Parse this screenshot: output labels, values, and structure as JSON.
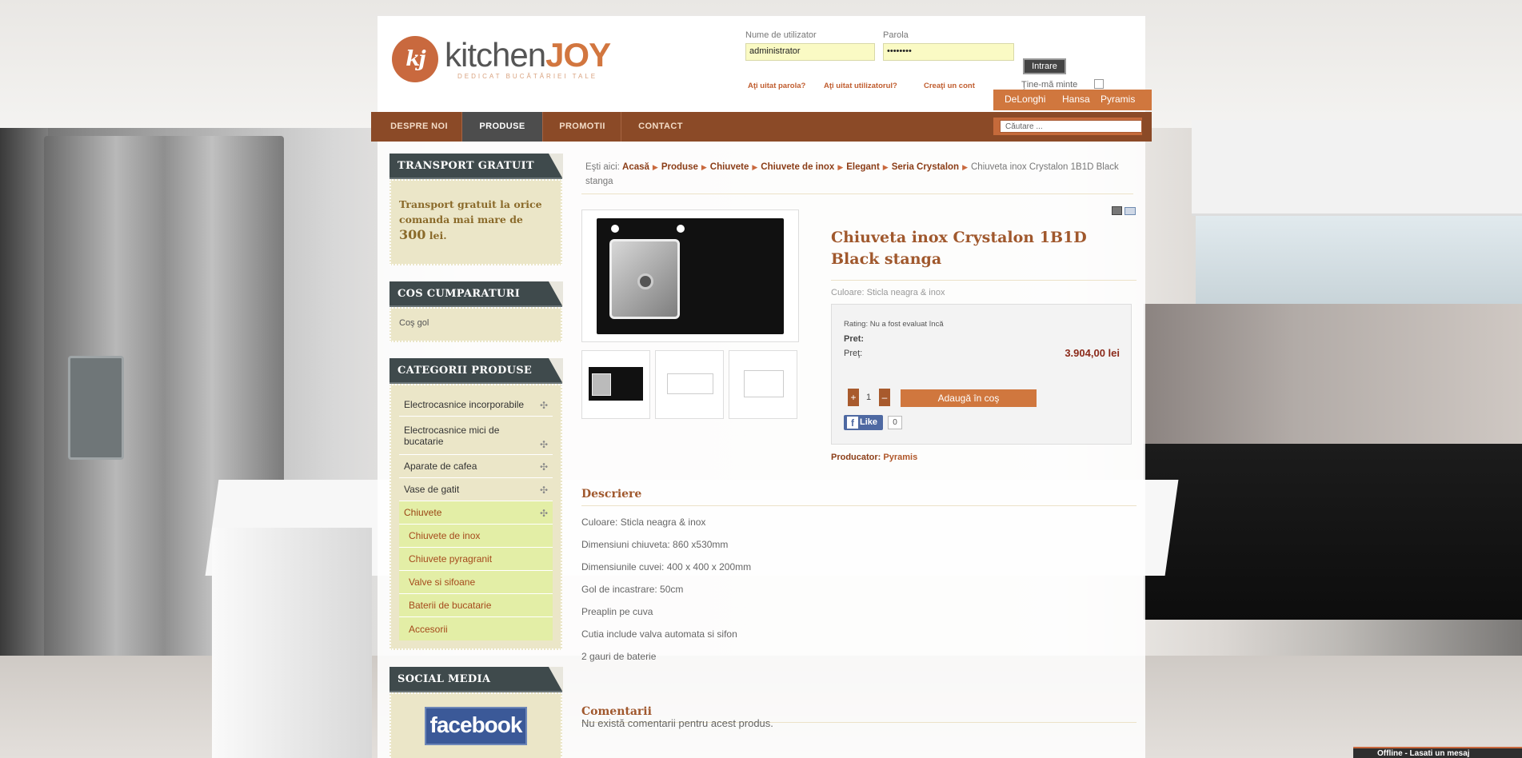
{
  "header": {
    "logo_mark": "kj",
    "logo_kitchen": "kitchen",
    "logo_joy": "JOY",
    "logo_tagline": "DEDICAT BUCĂTĂRIEI TALE",
    "login": {
      "username_label": "Nume de utilizator",
      "username_value": "administrator",
      "password_label": "Parola",
      "password_value": "••••••••",
      "submit_label": "Intrare",
      "forgot_password": "Aţi uitat parola?",
      "forgot_username": "Aţi uitat utilizatorul?",
      "create_account": "Creaţi un cont",
      "remember_label": "Ţine-mă minte"
    },
    "brands": [
      "DeLonghi",
      "Hansa",
      "Pyramis"
    ],
    "nav": [
      "DESPRE NOI",
      "PRODUSE",
      "PROMOTII",
      "CONTACT"
    ],
    "search_placeholder": "Căutare ..."
  },
  "sidebar": {
    "transport": {
      "title": "TRANSPORT GRATUIT",
      "text": "Transport gratuit la orice comanda mai mare de",
      "amount": "300",
      "currency": "lei."
    },
    "cart": {
      "title": "COS CUMPARATURI",
      "empty": "Coş gol"
    },
    "categories": {
      "title": "CATEGORII PRODUSE",
      "items": [
        "Electrocasnice incorporabile",
        "Electrocasnice mici de bucatarie",
        "Aparate de cafea",
        "Vase de gatit",
        "Chiuvete"
      ],
      "subitems": [
        "Chiuvete de inox",
        "Chiuvete pyragranit",
        "Valve si sifoane",
        "Baterii de bucatarie",
        "Accesorii"
      ]
    },
    "social": {
      "title": "SOCIAL MEDIA",
      "facebook": "facebook"
    }
  },
  "breadcrumb": {
    "prefix": "Eşti aici:",
    "items": [
      "Acasă",
      "Produse",
      "Chiuvete",
      "Chiuvete de inox",
      "Elegant",
      "Seria Crystalon"
    ],
    "current": "Chiuveta inox Crystalon 1B1D Black stanga"
  },
  "product": {
    "title": "Chiuveta inox Crystalon 1B1D Black stanga",
    "color": "Culoare: Sticla neagra & inox",
    "rating": "Rating: Nu a fost evaluat încă",
    "price_heading": "Pret:",
    "price_label": "Preţ:",
    "price_value": "3.904,00 lei",
    "qty_plus": "+",
    "qty_value": "1",
    "qty_minus": "–",
    "add_to_cart": "Adaugă în coş",
    "fb_like": "Like",
    "fb_count": "0",
    "producer_label": "Producator:",
    "producer_value": "Pyramis"
  },
  "description": {
    "title": "Descriere",
    "lines": [
      "Culoare: Sticla neagra & inox",
      "Dimensiuni chiuveta: 860 x530mm",
      "Dimensiunile cuvei: 400 x 400 x 200mm",
      "Gol de incastrare: 50cm",
      "Preaplin pe cuva",
      "Cutia include valva automata si sifon",
      "2 gauri de baterie"
    ]
  },
  "comments": {
    "title": "Comentarii",
    "empty": "Nu există comentarii pentru acest produs."
  },
  "chat": {
    "status": "Offline - Lasati un mesaj"
  }
}
